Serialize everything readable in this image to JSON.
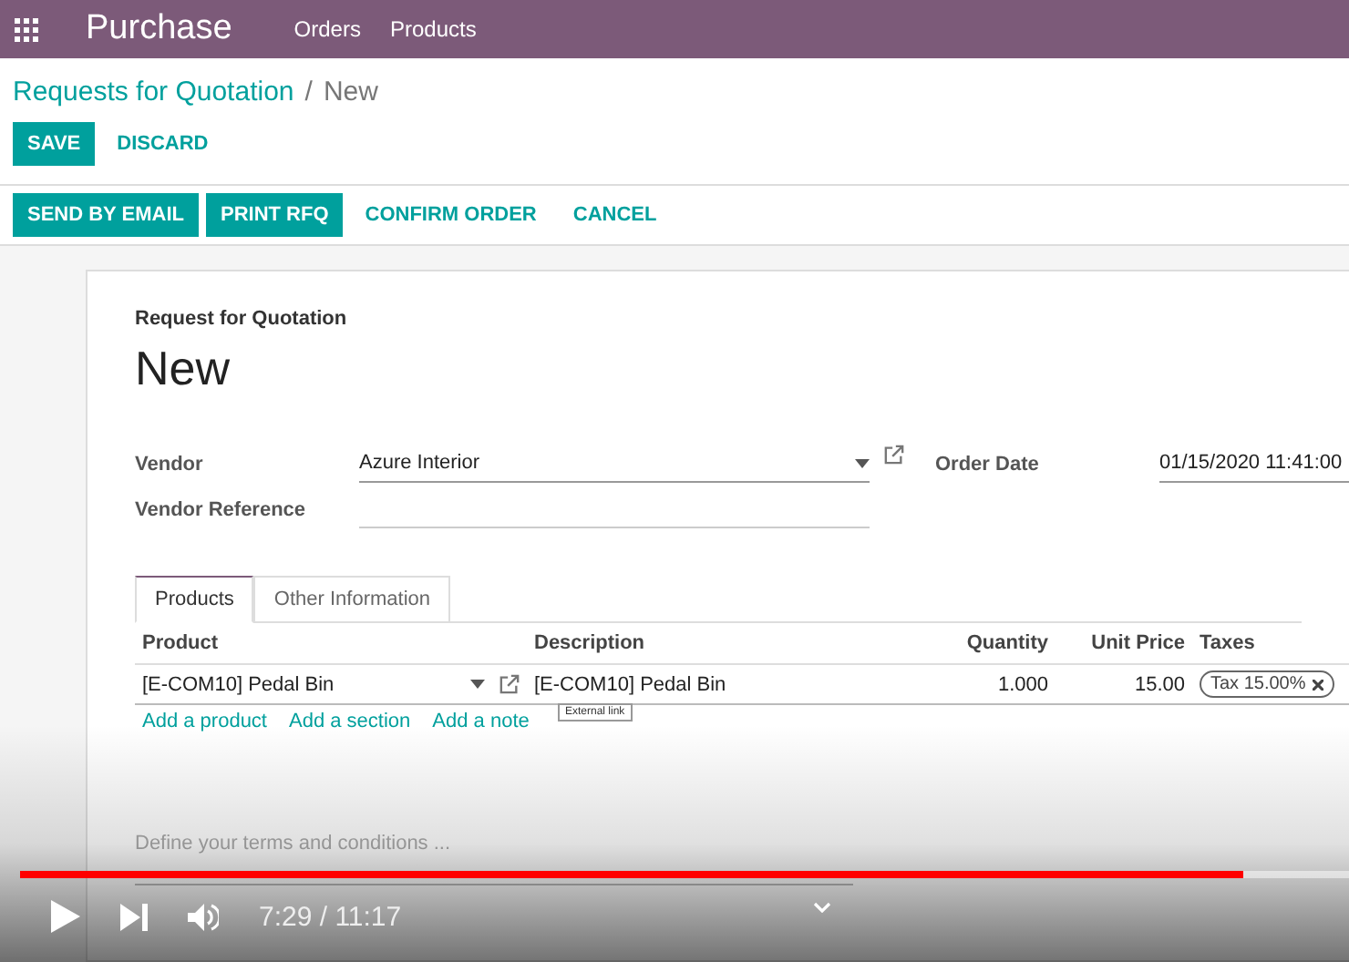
{
  "navbar": {
    "app_title": "Purchase",
    "menu": [
      {
        "label": "Orders"
      },
      {
        "label": "Products"
      }
    ]
  },
  "breadcrumb": {
    "parent": "Requests for Quotation",
    "separator": "/",
    "current": "New"
  },
  "form_buttons": [
    {
      "label": "SAVE",
      "kind": "primary"
    },
    {
      "label": "DISCARD",
      "kind": "link"
    }
  ],
  "status_buttons": [
    {
      "label": "SEND BY EMAIL",
      "kind": "primary"
    },
    {
      "label": "PRINT RFQ",
      "kind": "primary"
    },
    {
      "label": "CONFIRM ORDER",
      "kind": "link"
    },
    {
      "label": "CANCEL",
      "kind": "link"
    }
  ],
  "sheet": {
    "subtitle": "Request for Quotation",
    "title": "New",
    "vendor": {
      "label": "Vendor",
      "value": "Azure Interior"
    },
    "vendor_reference": {
      "label": "Vendor Reference"
    },
    "order_date": {
      "label": "Order Date",
      "value": "01/15/2020 11:41:00"
    },
    "tabs": [
      {
        "label": "Products",
        "selected": true
      },
      {
        "label": "Other Information",
        "selected": false
      }
    ],
    "table": {
      "columns": [
        "Product",
        "Description",
        "Quantity",
        "Unit Price",
        "Taxes"
      ],
      "rows": [
        {
          "product": "[E-COM10] Pedal Bin",
          "description": "[E-COM10] Pedal Bin",
          "quantity": "1.000",
          "unit_price": "15.00",
          "taxes": [
            "Tax 15.00%"
          ]
        }
      ],
      "add_links": [
        "Add a product",
        "Add a section",
        "Add a note"
      ]
    },
    "tooltip": "External link",
    "terms_placeholder": "Define your terms and conditions ..."
  },
  "video_player": {
    "progress": {
      "level": 0.92
    },
    "time": "7:29 / 11:17"
  }
}
